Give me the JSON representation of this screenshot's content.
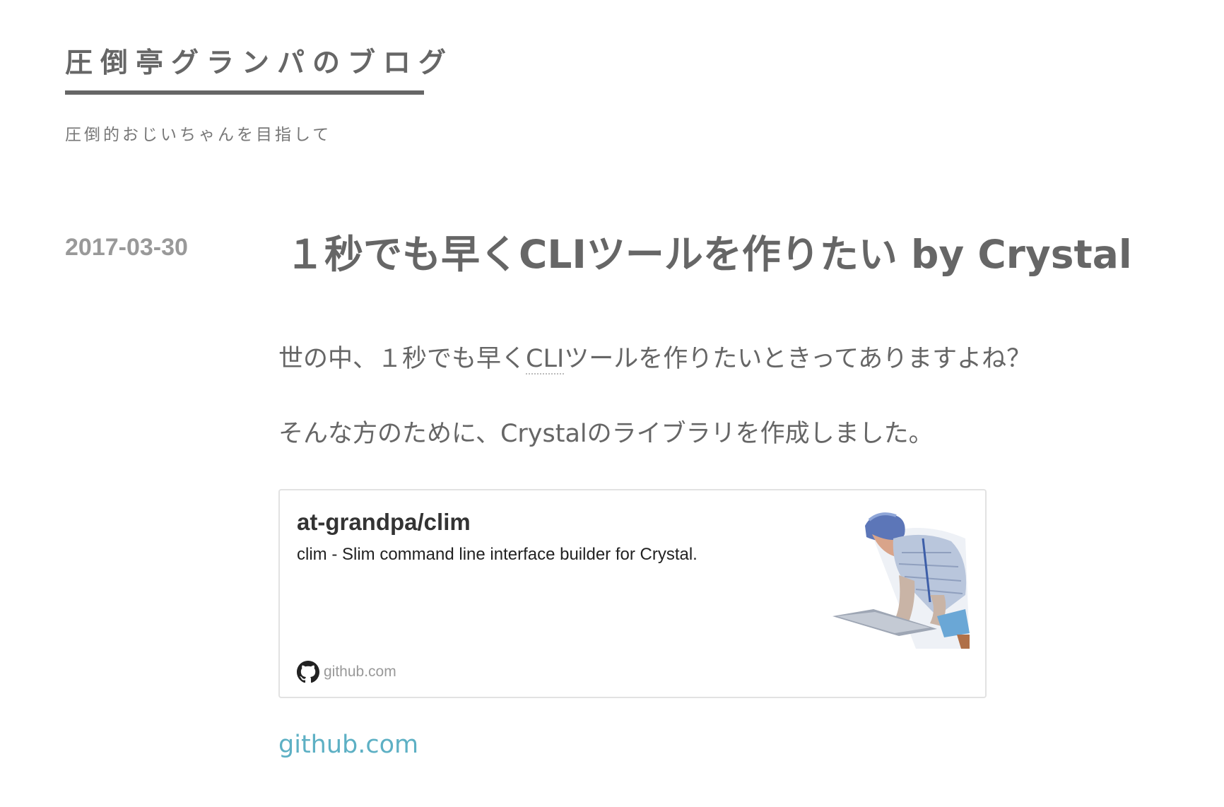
{
  "header": {
    "blog_title": "圧倒亭グランパのブログ",
    "tagline": "圧倒的おじいちゃんを目指して"
  },
  "entry": {
    "date": "2017-03-30",
    "title": "１秒でも早くCLIツールを作りたい by Crystal",
    "para1_before": "世の中、１秒でも早く",
    "para1_abbr": "CLI",
    "para1_after": "ツールを作りたいときってありますよね？",
    "para2": "そんな方のために、Crystalのライブラリを作成しました。"
  },
  "embed": {
    "title": "at-grandpa/clim",
    "description": "clim - Slim command line interface builder for Crystal.",
    "icon": "github-icon",
    "domain": "github.com",
    "thumbnail": "person-with-laptop-illustration"
  },
  "source_link": {
    "label": "github.com"
  },
  "colors": {
    "text": "#666666",
    "date": "#999999",
    "link": "#5db0c4",
    "card_border": "#e2e2e2"
  }
}
